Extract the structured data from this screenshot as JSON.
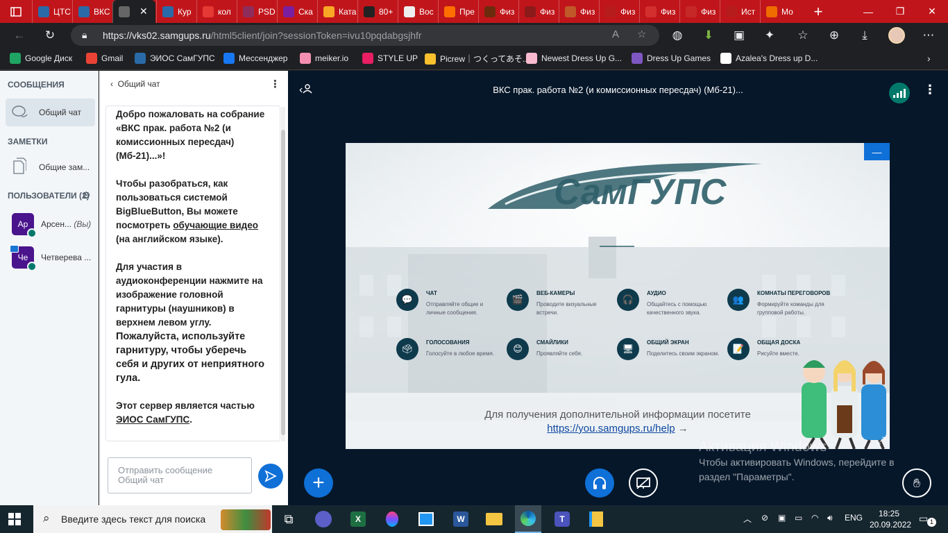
{
  "browser": {
    "tabs": [
      {
        "label": "ЦТС",
        "color": "#2a6aa8"
      },
      {
        "label": "ВКС",
        "color": "#2a6aa8"
      },
      {
        "label": "",
        "color": "#666666"
      },
      {
        "label": "Кур",
        "color": "#2a6aa8"
      },
      {
        "label": "кол",
        "color": "#e53935"
      },
      {
        "label": "PSD",
        "color": "#8e2d5c"
      },
      {
        "label": "Ска",
        "color": "#7b1fa2"
      },
      {
        "label": "Ката",
        "color": "#f9a825"
      },
      {
        "label": "80+",
        "color": "#222222"
      },
      {
        "label": "Вос",
        "color": "#eeeeee"
      },
      {
        "label": "Пре",
        "color": "#ff6f00"
      },
      {
        "label": "Физ",
        "color": "#6d2b0e"
      },
      {
        "label": "Физ",
        "color": "#8b1a1a"
      },
      {
        "label": "Физ",
        "color": "#c0582a"
      },
      {
        "label": "Физ",
        "color": "#b71c1c"
      },
      {
        "label": "Физ",
        "color": "#d32f2f"
      },
      {
        "label": "Физ",
        "color": "#c62828"
      },
      {
        "label": "Ист",
        "color": "#b71c1c"
      },
      {
        "label": "Мо",
        "color": "#ef6c00"
      }
    ],
    "new_tab": "+",
    "url_main": "https://vks02.samgups.ru",
    "url_rest": "/html5client/join?sessionToken=ivu10pqdabgsjhfr",
    "bookmarks": [
      {
        "label": "Google Диск",
        "color": "#1fa463"
      },
      {
        "label": "Gmail",
        "color": "#ea4335"
      },
      {
        "label": "ЭИОС СамГУПС",
        "color": "#2a6aa8"
      },
      {
        "label": "Мессенджер",
        "color": "#1877f2"
      },
      {
        "label": "meiker.io",
        "color": "#f48fb1"
      },
      {
        "label": "STYLE UP",
        "color": "#e91e63"
      },
      {
        "label": "Picrew｜つくってあそ...",
        "color": "#fbc02d"
      },
      {
        "label": "Newest Dress Up G...",
        "color": "#f8bbd0"
      },
      {
        "label": "Dress Up Games",
        "color": "#7e57c2"
      },
      {
        "label": "Azalea's Dress up D...",
        "color": "#ffffff"
      }
    ]
  },
  "userlist": {
    "messages_title": "СООБЩЕНИЯ",
    "public_chat": "Общий чат",
    "notes_title": "ЗАМЕТКИ",
    "shared_notes": "Общие зам...",
    "users_title": "ПОЛЬЗОВАТЕЛИ (2)",
    "users": [
      {
        "initials": "Ар",
        "name": "Арсен...",
        "you": "(Вы)"
      },
      {
        "initials": "Че",
        "name": "Четверева ..."
      }
    ]
  },
  "chat": {
    "back_label": "Общий чат",
    "welcome_lines": [
      "Добро пожаловать на собрание",
      "«ВКС прак. работа №2 (и комиссионных пересдач) (Мб-21)...»!"
    ],
    "p2_before": "Чтобы разобраться, как пользоваться системой BigBlueButton, Вы можете посмотреть ",
    "p2_link": "обучающие видео",
    "p2_after": " (на английском языке).",
    "p3_normal": "Для участия в аудиоконференции нажмите на изображение головной гарнитуры (наушников) в верхнем левом углу.",
    "p3_bold": "Пожалуйста, используйте гарнитуру, чтобы уберечь себя и других от неприятного гула.",
    "p4_before": "Этот сервер является частью ",
    "p4_link": "ЭИОС СамГУПС",
    "p4_after": ".",
    "input_placeholder": "Отправить сообщение Общий чат"
  },
  "main": {
    "meeting_title": "ВКС прак. работа №2 (и комиссионных пересдач) (Мб-21)...",
    "slide": {
      "logo_text": "СамГУПС",
      "features": [
        {
          "title": "ЧАТ",
          "desc": "Отправляйте общие и личные сообщения.",
          "icon": "💬"
        },
        {
          "title": "ВЕБ-КАМЕРЫ",
          "desc": "Проводите визуальные встречи.",
          "icon": "🎬"
        },
        {
          "title": "АУДИО",
          "desc": "Общайтесь с помощью качественного звука.",
          "icon": "🎧"
        },
        {
          "title": "КОМНАТЫ ПЕРЕГОВОРОВ",
          "desc": "Формируйте команды для групповой работы.",
          "icon": "👥"
        },
        {
          "title": "ГОЛОСОВАНИЯ",
          "desc": "Голосуйте в любое время.",
          "icon": "🗳"
        },
        {
          "title": "СМАЙЛИКИ",
          "desc": "Проявляйте себя.",
          "icon": "😊"
        },
        {
          "title": "ОБЩИЙ ЭКРАН",
          "desc": "Поделитесь своим экраном.",
          "icon": "🖥"
        },
        {
          "title": "ОБЩАЯ ДОСКА",
          "desc": "Рисуйте вместе.",
          "icon": "📝"
        }
      ],
      "help_text": "Для получения дополнительной информации посетите",
      "help_link": "https://you.samgups.ru/help"
    },
    "activation_title": "Активация Windows",
    "activation_text": "Чтобы активировать Windows, перейдите в раздел \"Параметры\"."
  },
  "taskbar": {
    "search_placeholder": "Введите здесь текст для поиска",
    "lang": "ENG",
    "time": "18:25",
    "date": "20.09.2022",
    "notif_count": "1"
  }
}
